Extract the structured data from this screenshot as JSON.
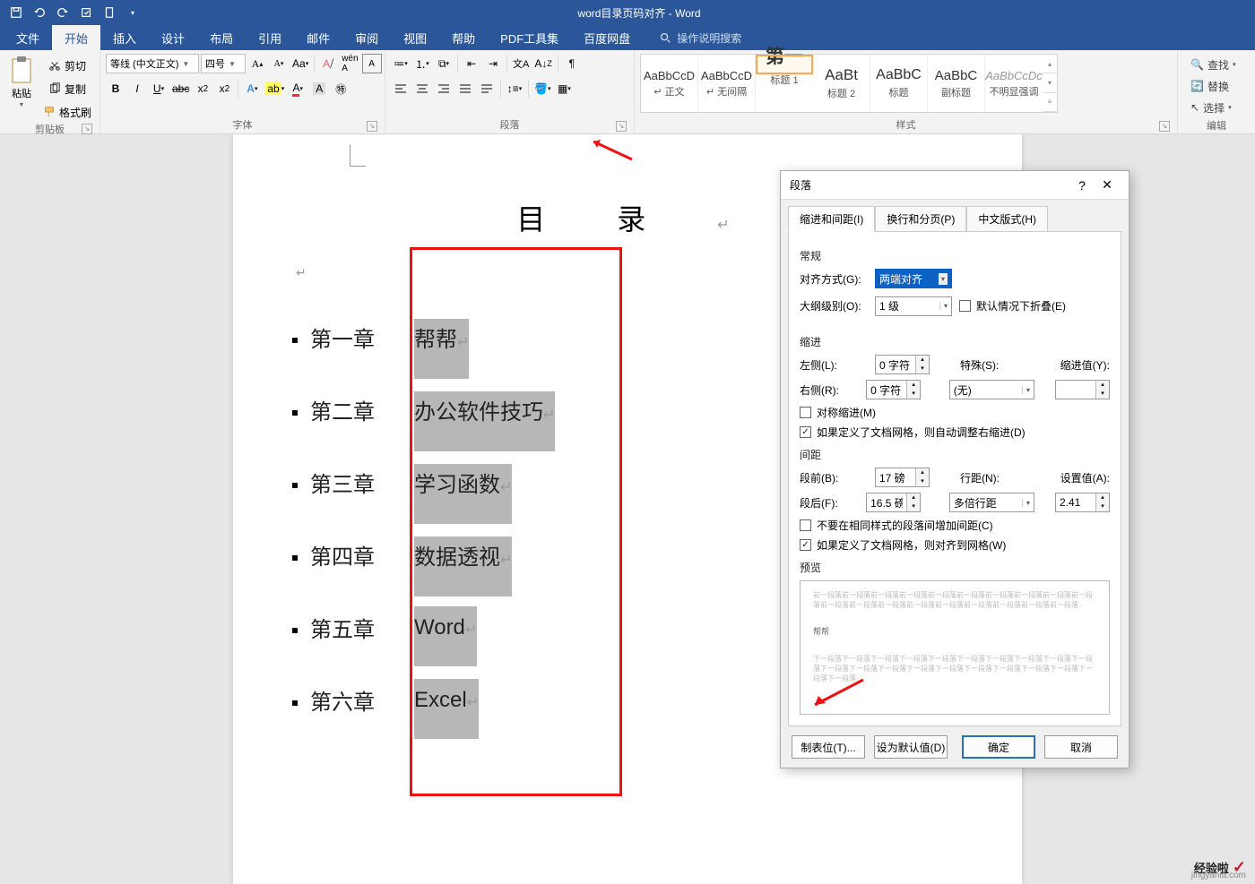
{
  "titlebar": {
    "doc_title": "word目录页码对齐 - Word"
  },
  "tabs": {
    "file": "文件",
    "home": "开始",
    "insert": "插入",
    "design": "设计",
    "layout": "布局",
    "references": "引用",
    "mailings": "邮件",
    "review": "审阅",
    "view": "视图",
    "help": "帮助",
    "pdf": "PDF工具集",
    "baidu": "百度网盘",
    "tellme": "操作说明搜索"
  },
  "ribbon": {
    "clipboard": {
      "paste": "粘贴",
      "cut": "剪切",
      "copy": "复制",
      "fmt": "格式刷",
      "label": "剪贴板"
    },
    "font": {
      "name": "等线 (中文正文)",
      "size": "四号",
      "label": "字体"
    },
    "para": {
      "label": "段落"
    },
    "styles": {
      "label": "样式",
      "items": [
        {
          "preview": "AaBbCcD",
          "name": "↵ 正文"
        },
        {
          "preview": "AaBbCcD",
          "name": "↵ 无间隔"
        },
        {
          "preview": "第一",
          "name": "标题 1"
        },
        {
          "preview": "AaBt",
          "name": "标题 2"
        },
        {
          "preview": "AaBbC",
          "name": "标题"
        },
        {
          "preview": "AaBbC",
          "name": "副标题"
        },
        {
          "preview": "AaBbCcDc",
          "name": "不明显强调"
        }
      ]
    },
    "editing": {
      "find": "查找",
      "replace": "替换",
      "select": "选择",
      "label": "编辑"
    }
  },
  "document": {
    "title": "目录",
    "toc": [
      {
        "chapter": "第一章",
        "text": "帮帮"
      },
      {
        "chapter": "第二章",
        "text": "办公软件技巧"
      },
      {
        "chapter": "第三章",
        "text": "学习函数"
      },
      {
        "chapter": "第四章",
        "text": "数据透视"
      },
      {
        "chapter": "第五章",
        "text": "Word"
      },
      {
        "chapter": "第六章",
        "text": "Excel"
      }
    ]
  },
  "dialog": {
    "title": "段落",
    "tabs": {
      "t1": "缩进和间距(I)",
      "t2": "换行和分页(P)",
      "t3": "中文版式(H)"
    },
    "general": "常规",
    "align_label": "对齐方式(G):",
    "align_value": "两端对齐",
    "outline_label": "大纲级别(O):",
    "outline_value": "1 级",
    "collapse": "默认情况下折叠(E)",
    "indent": "缩进",
    "left_label": "左侧(L):",
    "left_value": "0 字符",
    "right_label": "右侧(R):",
    "right_value": "0 字符",
    "special_label": "特殊(S):",
    "special_value": "(无)",
    "indval_label": "缩进值(Y):",
    "indval_value": "",
    "sym": "对称缩进(M)",
    "auto_indent": "如果定义了文档网格，则自动调整右缩进(D)",
    "spacing": "间距",
    "before_label": "段前(B):",
    "before_value": "17 磅",
    "after_label": "段后(F):",
    "after_value": "16.5 磅",
    "line_label": "行距(N):",
    "line_value": "多倍行距",
    "setval_label": "设置值(A):",
    "setval_value": "2.41",
    "no_space": "不要在相同样式的段落间增加间距(C)",
    "snap_grid": "如果定义了文档网格，则对齐到网格(W)",
    "preview": "预览",
    "preview_text1": "前一段落前一段落前一段落前一段落前一段落前一段落前一段落前一段落前一段落前一段落前一段落前一段落前一段落前一段落前一段落前一段落前一段落前一段落前一段落",
    "preview_dark": "帮帮",
    "preview_text2": "下一段落下一段落下一段落下一段落下一段落下一段落下一段落下一段落下一段落下一段落下一段落下一段落下一段落下一段落下一段落下一段落下一段落下一段落下一段落下一段落下一段落",
    "tab_btn": "制表位(T)...",
    "default_btn": "设为默认值(D)",
    "ok": "确定",
    "cancel": "取消"
  },
  "watermark": {
    "cn": "经验啦",
    "check": "✓",
    "en": "jingyanla.com"
  }
}
